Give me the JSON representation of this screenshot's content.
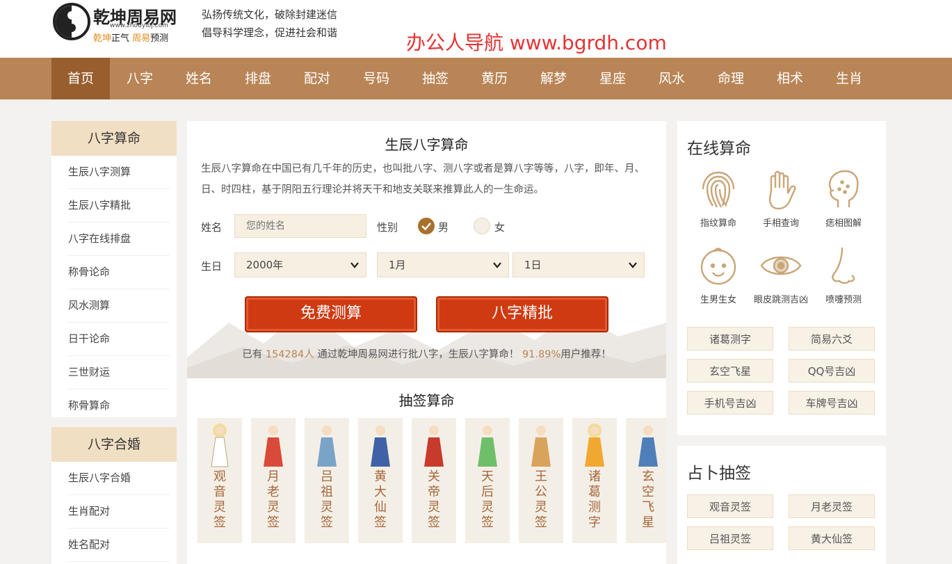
{
  "header": {
    "site_name": "乾坤周易网",
    "site_url": "www.zhouyibj.com",
    "slogan_a": "乾坤",
    "slogan_b": "正气 ",
    "slogan_c": "周易",
    "slogan_d": "预测",
    "tagline_1": "弘扬传统文化，破除封建迷信",
    "tagline_2": "倡导科学理念，促进社会和谐",
    "watermark": "办公人导航 www.bgrdh.com"
  },
  "nav": [
    "首页",
    "八字",
    "姓名",
    "排盘",
    "配对",
    "号码",
    "抽签",
    "黄历",
    "解梦",
    "星座",
    "风水",
    "命理",
    "相术",
    "生肖"
  ],
  "left": {
    "sec1_title": "八字算命",
    "sec1_items": [
      "生辰八字测算",
      "生辰八字精批",
      "八字在线排盘",
      "称骨论命",
      "风水测算",
      "日干论命",
      "三世财运",
      "称骨算命"
    ],
    "sec2_title": "八字合婚",
    "sec2_items": [
      "生辰八字合婚",
      "生肖配对",
      "姓名配对"
    ]
  },
  "main": {
    "title": "生辰八字算命",
    "description": "生辰八字算命在中国已有几千年的历史，也叫批八字、测八字或者是算八字等等，八字，即年、月、日、时四柱，基于阴阳五行理论并将天干和地支关联来推算此人的一生命运。",
    "name_label": "姓名",
    "name_placeholder": "您的姓名",
    "gender_label": "性别",
    "gender_male": "男",
    "gender_female": "女",
    "birthday_label": "生日",
    "year_value": "2000年",
    "month_value": "1月",
    "day_value": "1日",
    "btn_free": "免费测算",
    "btn_detail": "八字精批",
    "stats_pre": "已有 ",
    "stats_count": "154284人",
    "stats_mid": " 通过乾坤周易网进行批八字，生辰八字算命！ ",
    "stats_percent": "91.89%",
    "stats_post": "用户推荐！",
    "sub_title": "抽签算命",
    "cards": [
      "观音灵签",
      "月老灵签",
      "吕祖灵签",
      "黄大仙签",
      "关帝灵签",
      "天后灵签",
      "王公灵签",
      "诸葛测字",
      "玄空飞星"
    ]
  },
  "right": {
    "box1_title": "在线算命",
    "icons": [
      {
        "label": "指纹算命",
        "icon": "fingerprint-icon"
      },
      {
        "label": "手相查询",
        "icon": "palm-icon"
      },
      {
        "label": "痣相图解",
        "icon": "face-mole-icon"
      },
      {
        "label": "生男生女",
        "icon": "baby-face-icon"
      },
      {
        "label": "眼皮跳测吉凶",
        "icon": "eye-icon"
      },
      {
        "label": "喷嚏预测",
        "icon": "nose-icon"
      }
    ],
    "box1_buttons": [
      "诸葛测字",
      "简易六爻",
      "玄空飞星",
      "QQ号吉凶",
      "手机号吉凶",
      "车牌号吉凶"
    ],
    "box2_title": "占卜抽签",
    "box2_buttons": [
      "观音灵签",
      "月老灵签",
      "吕祖灵签",
      "黄大仙签"
    ]
  },
  "colors": {
    "nav_bg": "#b98556",
    "nav_active": "#995e2e",
    "accent_red": "#cf3a12",
    "section_head": "#f1dfc4"
  }
}
